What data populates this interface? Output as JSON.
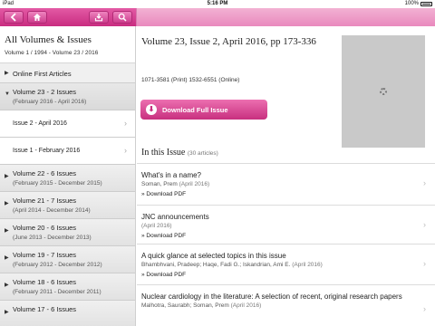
{
  "status_bar": {
    "carrier": "iPad",
    "time": "5:16 PM",
    "battery": "100%"
  },
  "sidebar": {
    "title": "All Volumes & Issues",
    "subtitle": "Volume 1 / 1994 - Volume 23 / 2016",
    "online_first": "Online First Articles",
    "volumes": [
      {
        "label": "Volume 23 - 2 Issues",
        "range": "(February 2016 - April 2016)"
      },
      {
        "label": "Volume 22 - 6 Issues",
        "range": "(February 2015 - December 2015)"
      },
      {
        "label": "Volume 21 - 7 Issues",
        "range": "(April 2014 - December 2014)"
      },
      {
        "label": "Volume 20 - 6 Issues",
        "range": "(June 2013 - December 2013)"
      },
      {
        "label": "Volume 19 - 7 Issues",
        "range": "(February 2012 - December 2012)"
      },
      {
        "label": "Volume 18 - 6 Issues",
        "range": "(February 2011 - December 2011)"
      },
      {
        "label": "Volume 17 - 6 Issues",
        "range": ""
      }
    ],
    "issues": [
      "Issue 2 - April 2016",
      "Issue 1 - February 2016"
    ]
  },
  "main": {
    "issue_title": "Volume 23, Issue 2, April 2016, pp 173-336",
    "issn": "1071-3581 (Print) 1532-6551 (Online)",
    "download_label": "Download Full Issue",
    "in_this_issue": "In this Issue",
    "article_count": "(30 articles)",
    "download_pdf": "Download PDF",
    "articles": [
      {
        "title": "What's in a name?",
        "authors": "Soman, Prem",
        "date": "(April 2016)"
      },
      {
        "title": "JNC announcements",
        "authors": "",
        "date": "(April 2016)"
      },
      {
        "title": "A quick glance at selected topics in this issue",
        "authors": "Bhambhvani, Pradeep; Haqe, Fadi G.; Iskandrian, Ami E.",
        "date": "(April 2016)"
      },
      {
        "title": "Nuclear cardiology in the literature: A selection of recent, original research papers",
        "authors": "Malhotra, Saurabh; Soman, Prem",
        "date": "(April 2016)"
      }
    ]
  }
}
